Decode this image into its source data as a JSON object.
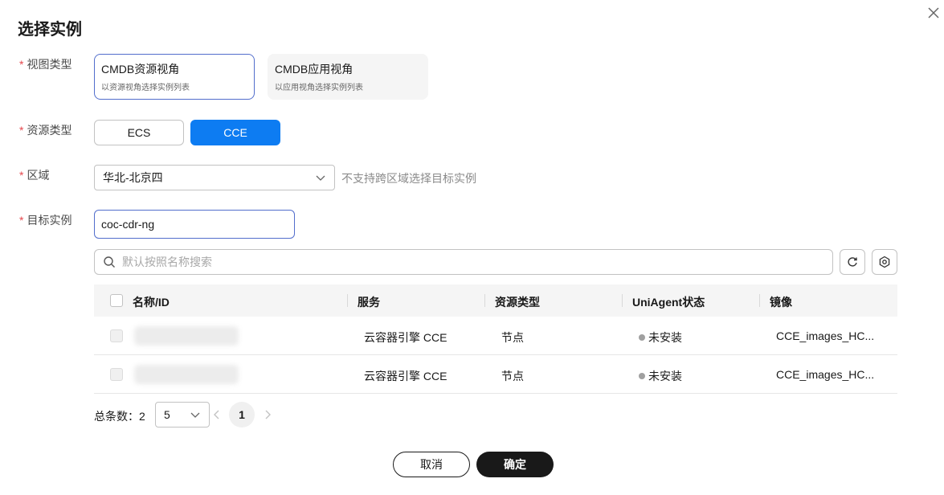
{
  "dialog": {
    "title": "选择实例"
  },
  "form": {
    "view_type": {
      "label": "视图类型",
      "options": [
        {
          "title": "CMDB资源视角",
          "desc": "以资源视角选择实例列表",
          "selected": true
        },
        {
          "title": "CMDB应用视角",
          "desc": "以应用视角选择实例列表",
          "selected": false
        }
      ]
    },
    "resource_type": {
      "label": "资源类型",
      "options": [
        "ECS",
        "CCE"
      ],
      "selected": "CCE"
    },
    "region": {
      "label": "区域",
      "value": "华北-北京四",
      "hint": "不支持跨区域选择目标实例"
    },
    "target_instance": {
      "label": "目标实例",
      "value": "coc-cdr-ng"
    },
    "required_mark": "*"
  },
  "search": {
    "placeholder": "默认按照名称搜索"
  },
  "table": {
    "columns": [
      "名称/ID",
      "服务",
      "资源类型",
      "UniAgent状态",
      "镜像"
    ],
    "rows": [
      {
        "name": "",
        "service": "云容器引擎 CCE",
        "resource_type": "节点",
        "agent_status": "未安装",
        "image": "CCE_images_HC..."
      },
      {
        "name": "",
        "service": "云容器引擎 CCE",
        "resource_type": "节点",
        "agent_status": "未安装",
        "image": "CCE_images_HC..."
      }
    ]
  },
  "pagination": {
    "total_label": "总条数：2",
    "page_size": "5",
    "current_page": "1"
  },
  "footer": {
    "cancel": "取消",
    "confirm": "确定"
  },
  "colors": {
    "primary": "#0d7cf2",
    "selected_border": "#526ecc",
    "required": "#e5484d",
    "dark_button": "#191919"
  }
}
